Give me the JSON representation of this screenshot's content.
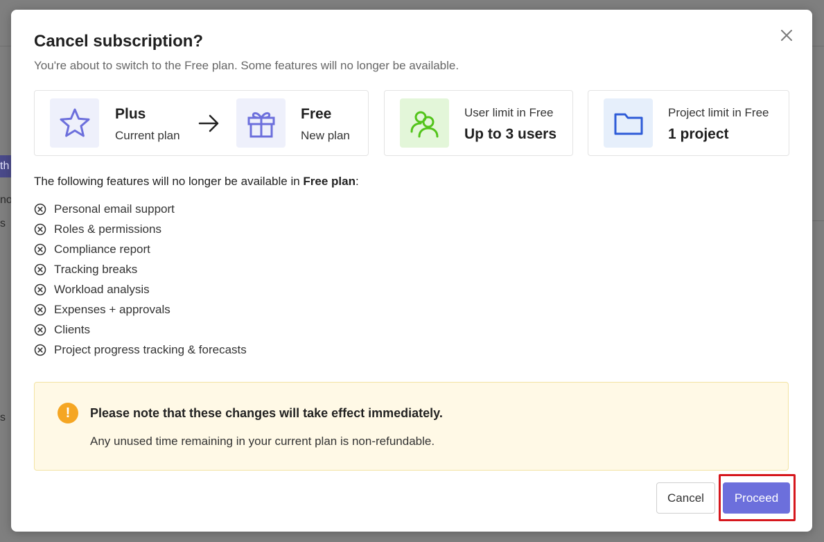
{
  "background_fragments": {
    "frag1": "th",
    "frag2": "no",
    "frag3": "s",
    "frag4": "s"
  },
  "dialog": {
    "title": "Cancel subscription?",
    "subtitle": "You're about to switch to the Free plan. Some features will no longer be available.",
    "close_icon": "close-icon"
  },
  "plan_change": {
    "current": {
      "name": "Plus",
      "label": "Current plan",
      "icon": "star-icon"
    },
    "arrow_icon": "arrow-right-icon",
    "new": {
      "name": "Free",
      "label": "New plan",
      "icon": "gift-icon"
    }
  },
  "limits": [
    {
      "label": "User limit in Free",
      "value": "Up to 3 users",
      "icon": "users-icon"
    },
    {
      "label": "Project limit in Free",
      "value": "1 project",
      "icon": "folder-icon"
    }
  ],
  "features": {
    "intro_prefix": "The following features will no longer be available in ",
    "intro_plan": "Free plan",
    "intro_suffix": ":",
    "items": [
      "Personal email support",
      "Roles & permissions",
      "Compliance report",
      "Tracking breaks",
      "Workload analysis",
      "Expenses + approvals",
      "Clients",
      "Project progress tracking & forecasts"
    ]
  },
  "notice": {
    "icon": "warning-icon",
    "icon_glyph": "!",
    "title": "Please note that these changes will take effect immediately.",
    "body": "Any unused time remaining in your current plan is non-refundable."
  },
  "actions": {
    "cancel_label": "Cancel",
    "proceed_label": "Proceed"
  },
  "colors": {
    "accent": "#6c6fdc",
    "warning": "#f5a623",
    "notice_bg": "#fff9e6",
    "highlight": "#d6171d",
    "users_icon": "#52c41a",
    "folder_icon": "#2d5bd7"
  }
}
